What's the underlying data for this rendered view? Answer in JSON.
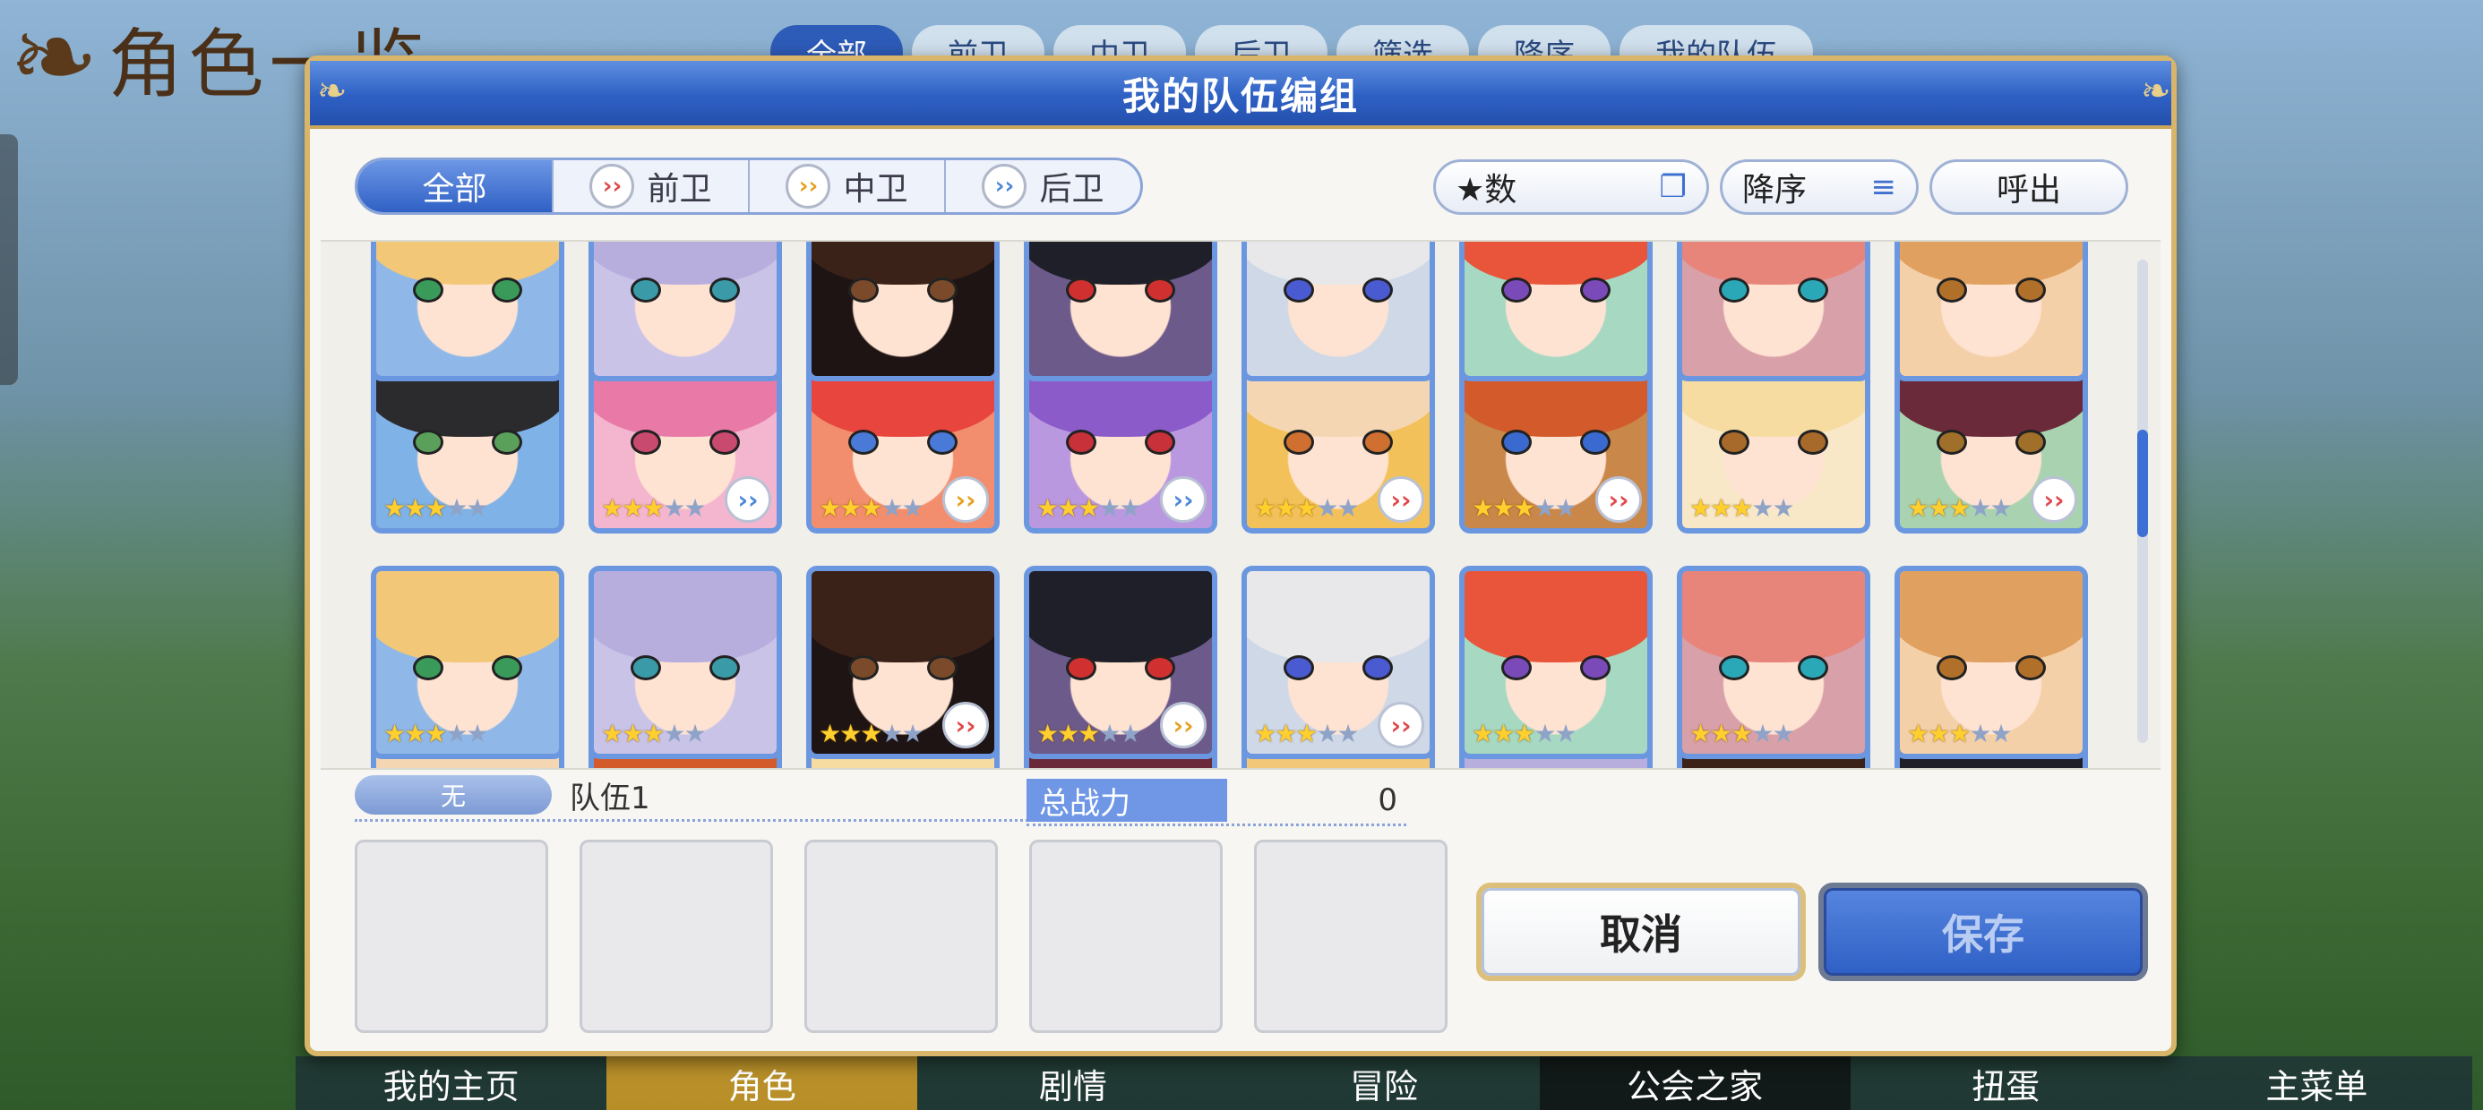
{
  "background": {
    "title": "角色一览",
    "tabs": [
      "全部",
      "前卫",
      "中卫",
      "后卫",
      "筛选",
      "降序",
      "我的队伍"
    ],
    "bottom_nav": [
      "我的主页",
      "角色",
      "剧情",
      "冒险",
      "公会之家",
      "扭蛋",
      "主菜单"
    ]
  },
  "dialog": {
    "title": "我的队伍编组",
    "role_tabs": [
      {
        "label": "全部",
        "icon": ""
      },
      {
        "label": "前卫",
        "icon": "front-role-icon"
      },
      {
        "label": "中卫",
        "icon": "mid-role-icon"
      },
      {
        "label": "后卫",
        "icon": "back-role-icon"
      }
    ],
    "sort_key": "★数",
    "sort_order": "降序",
    "recall": "呼出",
    "team": {
      "label": "无",
      "name": "队伍1",
      "power_label": "总战力",
      "power_value": "0"
    },
    "cancel": "取消",
    "save": "保存"
  },
  "roster": [
    {
      "stars": 3,
      "position": "",
      "hair": "#2b2b2e",
      "bg": "#7fb2e6",
      "eye": "#5aa05a"
    },
    {
      "stars": 3,
      "position": "back",
      "hair": "#e97aa8",
      "bg": "#f4b6cf",
      "eye": "#c84a6e"
    },
    {
      "stars": 3,
      "position": "mid",
      "hair": "#e8453f",
      "bg": "#f28e6e",
      "eye": "#4a7ad8"
    },
    {
      "stars": 3,
      "position": "back",
      "hair": "#8b5bc9",
      "bg": "#b998e0",
      "eye": "#c8303a"
    },
    {
      "stars": 3,
      "position": "front",
      "hair": "#f4d6b2",
      "bg": "#f3c15a",
      "eye": "#d07030"
    },
    {
      "stars": 3,
      "position": "front",
      "hair": "#d35a2a",
      "bg": "#c9874a",
      "eye": "#3a6ad0"
    },
    {
      "stars": 3,
      "position": "",
      "hair": "#f6dca0",
      "bg": "#f8e8c8",
      "eye": "#a86a2a"
    },
    {
      "stars": 3,
      "position": "front",
      "hair": "#6a2a3a",
      "bg": "#a9d3b0",
      "eye": "#a0702a"
    },
    {
      "stars": 3,
      "position": "",
      "hair": "#f2c778",
      "bg": "#8fb8e8",
      "eye": "#3a9a5a"
    },
    {
      "stars": 3,
      "position": "",
      "hair": "#b7aede",
      "bg": "#c9c3e8",
      "eye": "#3a9aa8"
    },
    {
      "stars": 3,
      "position": "front",
      "hair": "#3a2218",
      "bg": "#1e1414",
      "eye": "#7a4a2a"
    },
    {
      "stars": 3,
      "position": "mid",
      "hair": "#1f1f2a",
      "bg": "#6b5a8a",
      "eye": "#d03030"
    },
    {
      "stars": 3,
      "position": "front",
      "hair": "#e8e8ea",
      "bg": "#cfd8e6",
      "eye": "#4a5ad0"
    },
    {
      "stars": 3,
      "position": "",
      "hair": "#e8553a",
      "bg": "#a6d8c2",
      "eye": "#7a4ab8"
    },
    {
      "stars": 3,
      "position": "",
      "hair": "#e8857a",
      "bg": "#d8a0a8",
      "eye": "#2aa8b8"
    },
    {
      "stars": 3,
      "position": "",
      "hair": "#e0a060",
      "bg": "#f4d0a8",
      "eye": "#b0702a"
    }
  ]
}
